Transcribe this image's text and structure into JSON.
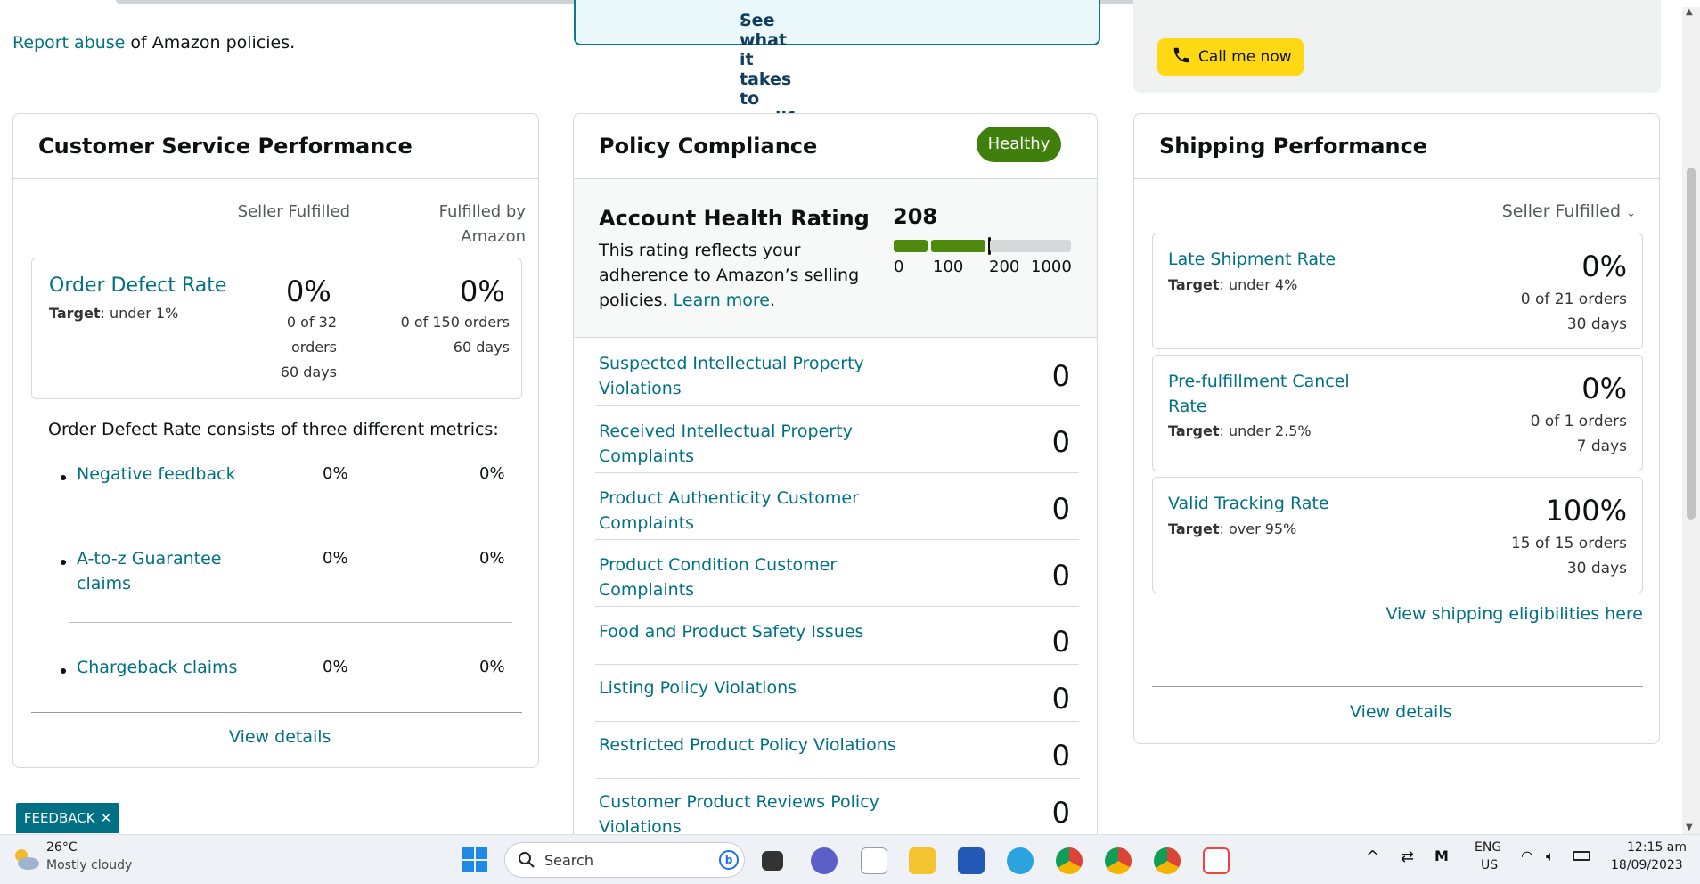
{
  "top": {
    "report_link": "Report abuse",
    "report_rest": " of Amazon policies.",
    "qualify": "See what it takes to qualify",
    "call_button": "Call me now"
  },
  "customer_service": {
    "title": "Customer Service Performance",
    "col_seller": "Seller Fulfilled",
    "col_fba_1": "Fulfilled by",
    "col_fba_2": "Amazon",
    "odr": {
      "name": "Order Defect Rate",
      "target_label": "Target",
      "target_value": ": under 1%",
      "seller_pct": "0%",
      "seller_sub_1": "0 of 32",
      "seller_sub_2": "orders",
      "seller_sub_3": "60 days",
      "fba_pct": "0%",
      "fba_sub_1": "0 of 150 orders",
      "fba_sub_2": "60 days"
    },
    "intro": "Order Defect Rate consists of three different metrics:",
    "metrics": [
      {
        "name": "Negative feedback",
        "seller": "0%",
        "fba": "0%"
      },
      {
        "name_1": "A-to-z Guarantee",
        "name_2": "claims",
        "seller": "0%",
        "fba": "0%"
      },
      {
        "name": "Chargeback claims",
        "seller": "0%",
        "fba": "0%"
      }
    ],
    "view_details": "View details"
  },
  "policy": {
    "title": "Policy Compliance",
    "badge": "Healthy",
    "ahr_title": "Account Health Rating",
    "ahr_desc": "This rating reflects your adherence to Amazon’s selling policies. ",
    "learn_more": "Learn more",
    "learn_after": ".",
    "score": "208",
    "ticks": [
      "0",
      "100",
      "200",
      "1000"
    ],
    "rows": [
      {
        "l1": "Suspected Intellectual Property",
        "l2": "Violations",
        "v": "0"
      },
      {
        "l1": "Received Intellectual Property",
        "l2": "Complaints",
        "v": "0"
      },
      {
        "l1": "Product Authenticity Customer",
        "l2": "Complaints",
        "v": "0"
      },
      {
        "l1": "Product Condition Customer",
        "l2": "Complaints",
        "v": "0"
      },
      {
        "l1": "Food and Product Safety Issues",
        "l2": "",
        "v": "0"
      },
      {
        "l1": "Listing Policy Violations",
        "l2": "",
        "v": "0"
      },
      {
        "l1": "Restricted Product Policy Violations",
        "l2": "",
        "v": "0"
      },
      {
        "l1": "Customer Product Reviews Policy",
        "l2": "Violations",
        "v": "0"
      }
    ]
  },
  "shipping": {
    "title": "Shipping Performance",
    "filter": "Seller Fulfilled",
    "items": [
      {
        "n1": "Late Shipment Rate",
        "n2": "",
        "target": ": under 4%",
        "pct": "0%",
        "s1": "0 of 21 orders",
        "s2": "30 days"
      },
      {
        "n1": "Pre-fulfillment Cancel",
        "n2": "Rate",
        "target": ": under 2.5%",
        "pct": "0%",
        "s1": "0 of 1 orders",
        "s2": "7 days"
      },
      {
        "n1": "Valid Tracking Rate",
        "n2": "",
        "target": ": over 95%",
        "pct": "100%",
        "s1": "15 of 15 orders",
        "s2": "30 days"
      }
    ],
    "target_label": "Target",
    "eligibility": "View shipping eligibilities here",
    "view_details": "View details"
  },
  "feedback": "FEEDBACK",
  "taskbar": {
    "temp": "26°C",
    "weather": "Mostly cloudy",
    "search": "Search",
    "lang1": "ENG",
    "lang2": "US",
    "time": "12:15 am",
    "date": "18/09/2023"
  },
  "colors": {
    "link": "#007185",
    "healthy": "#3f7f0b",
    "call": "#ffd814",
    "feedback": "#007185"
  }
}
